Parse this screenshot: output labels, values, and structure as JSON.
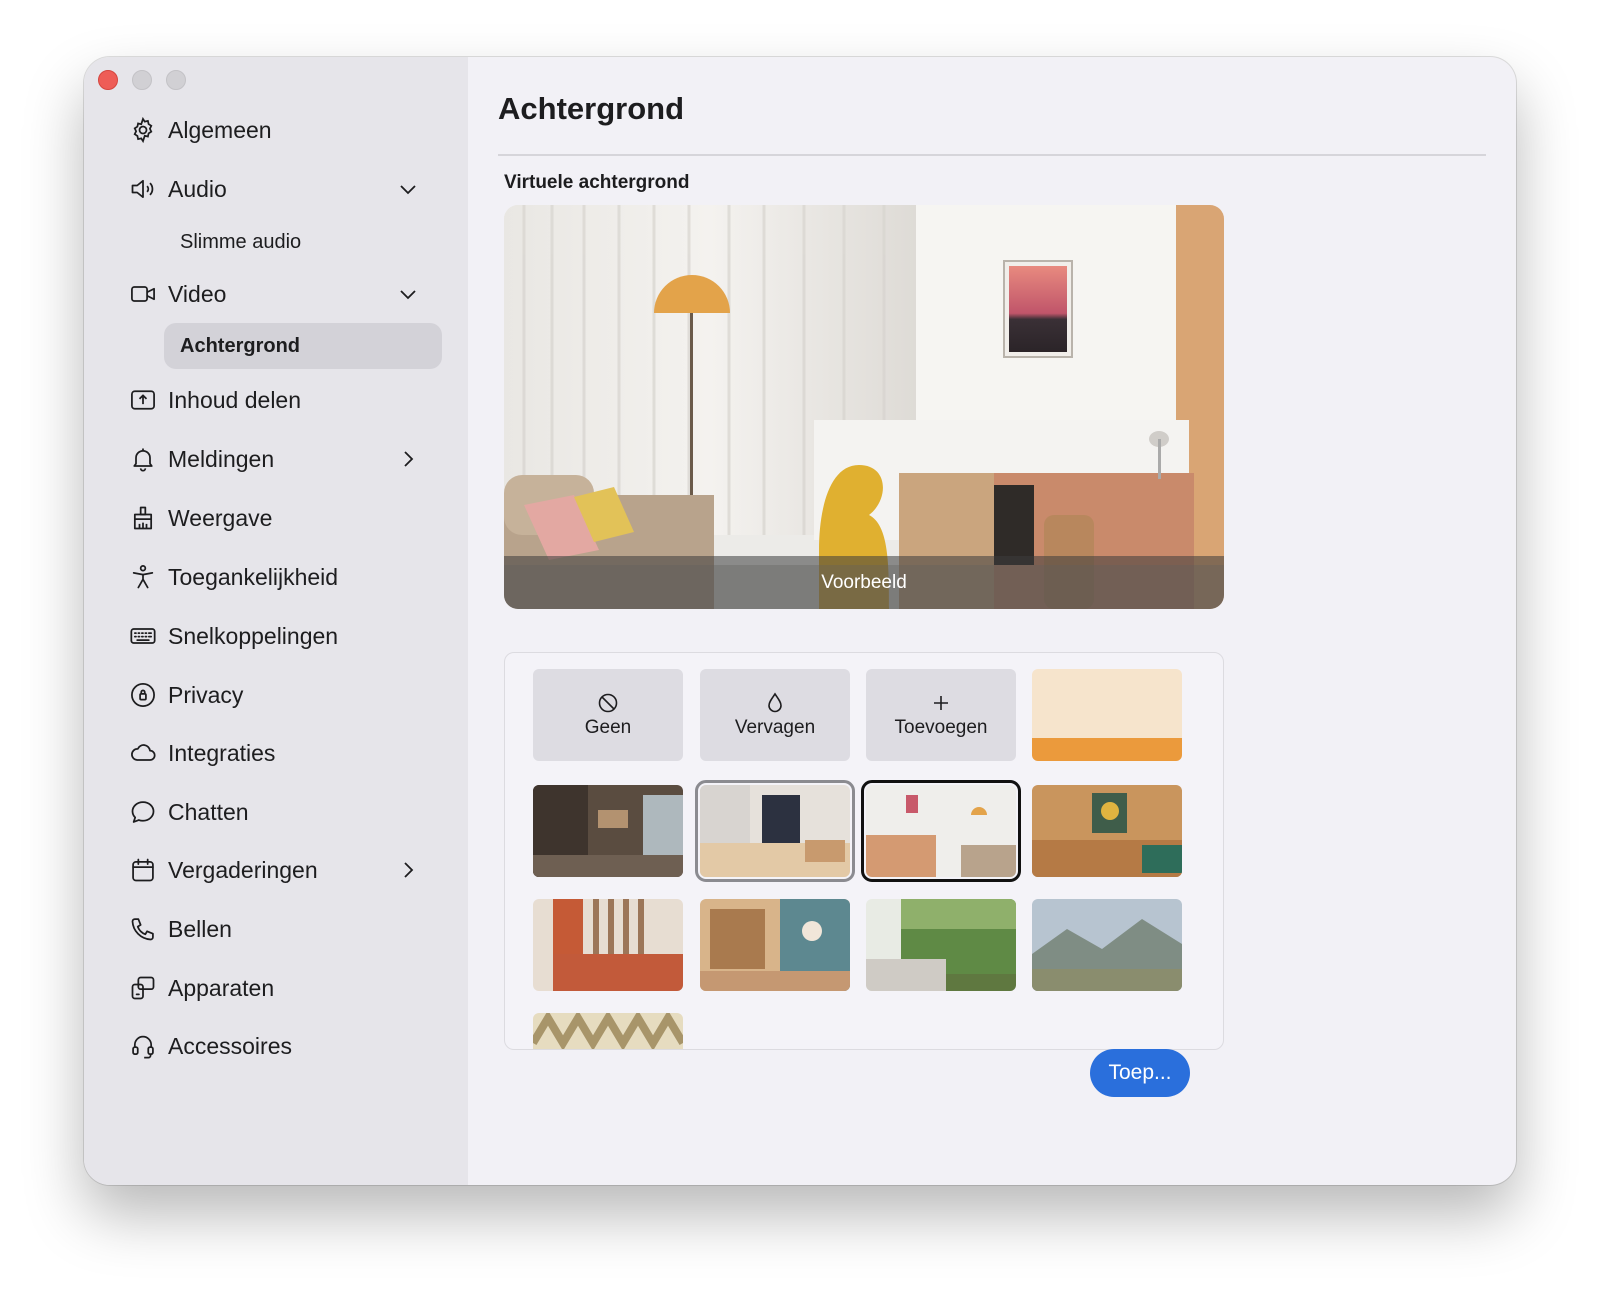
{
  "window": {
    "traffic_lights": [
      "close",
      "minimize",
      "maximize"
    ]
  },
  "sidebar": {
    "items": [
      {
        "label": "Algemeen",
        "icon": "gear-icon"
      },
      {
        "label": "Audio",
        "icon": "speaker-icon",
        "chevron": "down"
      },
      {
        "label": "Slimme audio",
        "sub": true
      },
      {
        "label": "Video",
        "icon": "video-camera-icon",
        "chevron": "down"
      },
      {
        "label": "Achtergrond",
        "sub": true,
        "active": true
      },
      {
        "label": "Inhoud delen",
        "icon": "share-screen-icon"
      },
      {
        "label": "Meldingen",
        "icon": "bell-icon",
        "chevron": "right"
      },
      {
        "label": "Weergave",
        "icon": "brush-icon"
      },
      {
        "label": "Toegankelijkheid",
        "icon": "accessibility-icon"
      },
      {
        "label": "Snelkoppelingen",
        "icon": "keyboard-icon"
      },
      {
        "label": "Privacy",
        "icon": "privacy-icon"
      },
      {
        "label": "Integraties",
        "icon": "cloud-icon"
      },
      {
        "label": "Chatten",
        "icon": "chat-bubble-icon"
      },
      {
        "label": "Vergaderingen",
        "icon": "calendar-icon",
        "chevron": "right"
      },
      {
        "label": "Bellen",
        "icon": "phone-icon"
      },
      {
        "label": "Apparaten",
        "icon": "devices-icon"
      },
      {
        "label": "Accessoires",
        "icon": "headset-icon"
      }
    ]
  },
  "main": {
    "title": "Achtergrond",
    "section_label": "Virtuele achtergrond",
    "preview_label": "Voorbeeld",
    "options": [
      {
        "label": "Geen",
        "icon": "none-circle-icon"
      },
      {
        "label": "Vervagen",
        "icon": "droplet-icon"
      },
      {
        "label": "Toevoegen",
        "icon": "plus-icon"
      }
    ],
    "apply_button": "Toep..."
  },
  "colors": {
    "accent": "#2a6fdc",
    "sidebar_bg": "#e6e5ea",
    "content_bg": "#f2f1f6",
    "active_item": "#d3d2d8"
  }
}
